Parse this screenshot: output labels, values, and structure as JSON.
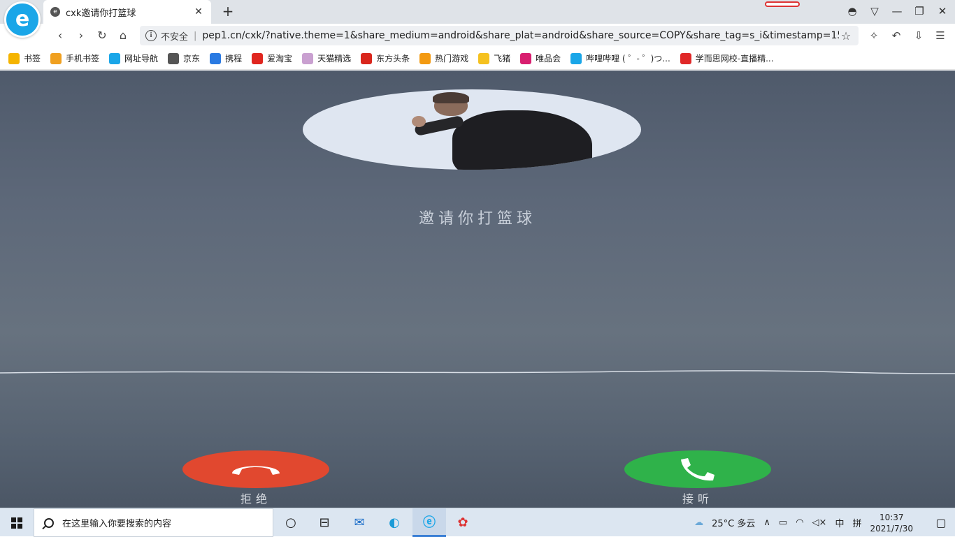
{
  "browser": {
    "tab_title": "cxk邀请你打篮球",
    "tab_favicon": "ie-e-icon",
    "new_tab_label": "+",
    "address": {
      "security_label": "不安全",
      "separator": "|",
      "url": "pep1.cn/cxk/?native.theme=1&share_medium=android&share_plat=android&share_source=COPY&share_tag=s_i&timestamp=158..."
    },
    "window_controls": [
      "minimize",
      "restore",
      "close"
    ],
    "bookmarks": [
      {
        "label": "书签",
        "icon": "star-icon",
        "color": "#f5b400"
      },
      {
        "label": "手机书签",
        "icon": "phone-icon",
        "color": "#f0a020"
      },
      {
        "label": "网址导航",
        "icon": "e-icon",
        "color": "#1aa6e8"
      },
      {
        "label": "京东",
        "icon": "jd-icon",
        "color": "#555555"
      },
      {
        "label": "携程",
        "icon": "ctrip-icon",
        "color": "#2a7ae2"
      },
      {
        "label": "爱淘宝",
        "icon": "taobao-icon",
        "color": "#e0261f"
      },
      {
        "label": "天猫精选",
        "icon": "tmall-icon",
        "color": "#c9a0d0"
      },
      {
        "label": "东方头条",
        "icon": "dftt-icon",
        "color": "#d9261c"
      },
      {
        "label": "热门游戏",
        "icon": "game-icon",
        "color": "#f39a12"
      },
      {
        "label": "飞猪",
        "icon": "fliggy-icon",
        "color": "#f5c11f"
      },
      {
        "label": "唯品会",
        "icon": "vip-icon",
        "color": "#d81e6f"
      },
      {
        "label": "哔哩哔哩 ( ゜- ゜)つ...",
        "icon": "bilibili-icon",
        "color": "#1aa6e8"
      },
      {
        "label": "学而思网校-直播精...",
        "icon": "xueersi-icon",
        "color": "#e02828"
      }
    ]
  },
  "call": {
    "caller_text": "邀请你打篮球",
    "decline_label": "拒绝",
    "accept_label": "接听",
    "decline_color": "#e1482f",
    "accept_color": "#2fb24a"
  },
  "taskbar": {
    "search_placeholder": "在这里输入你要搜索的内容",
    "weather": "25°C 多云",
    "ime": "中",
    "ime2": "拼",
    "time": "10:37",
    "date": "2021/7/30"
  }
}
